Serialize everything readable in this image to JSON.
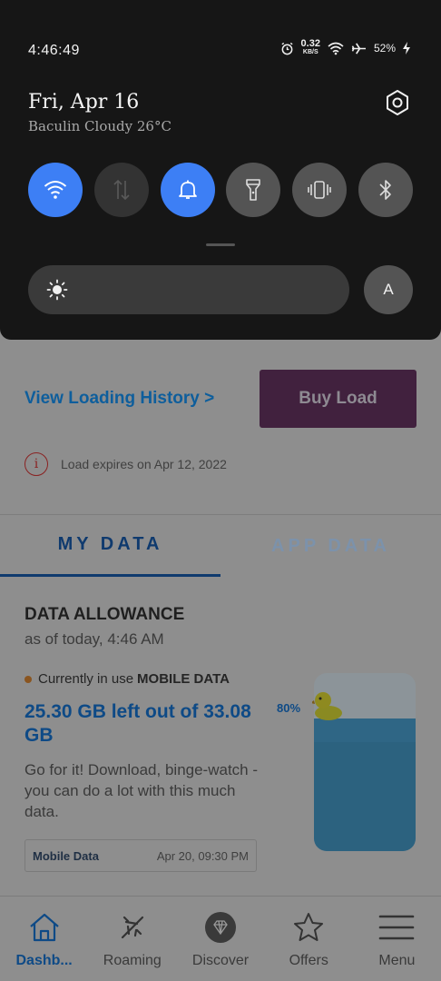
{
  "status_bar": {
    "time": "4:46:49",
    "net_speed_value": "0.32",
    "net_speed_unit": "KB/S",
    "battery": "52%"
  },
  "shade": {
    "date": "Fri, Apr 16",
    "weather": "Baculin Cloudy 26°C",
    "auto_brightness_label": "A",
    "tiles": [
      {
        "name": "wifi",
        "state": "on"
      },
      {
        "name": "mobile-data",
        "state": "off"
      },
      {
        "name": "sound",
        "state": "on"
      },
      {
        "name": "flashlight",
        "state": "off"
      },
      {
        "name": "vibrate",
        "state": "off"
      },
      {
        "name": "bluetooth",
        "state": "off"
      }
    ]
  },
  "load": {
    "history_link": "View Loading History >",
    "buy_button": "Buy Load",
    "expiry": "Load expires on Apr 12, 2022"
  },
  "tabs": {
    "my_data": "MY DATA",
    "app_data": "APP DATA"
  },
  "allowance": {
    "title": "DATA ALLOWANCE",
    "as_of": "as of today, 4:46 AM",
    "in_use_prefix": "Currently in use",
    "in_use_type": "MOBILE DATA",
    "left_text": "25.30 GB left out of 33.08 GB",
    "percent_label": "80%",
    "percent_value": 0.8,
    "message": "Go for it! Download, binge-watch - you can do a lot with this much data.",
    "plan_label": "Mobile Data",
    "plan_expiry": "Apr 20, 09:30 PM"
  },
  "nav": {
    "items": [
      {
        "label": "Dashb..."
      },
      {
        "label": "Roaming"
      },
      {
        "label": "Discover"
      },
      {
        "label": "Offers"
      },
      {
        "label": "Menu"
      }
    ]
  },
  "colors": {
    "accent_on": "#3d7ff5",
    "brand_blue": "#0e4a86",
    "buy_button": "#41213e"
  }
}
